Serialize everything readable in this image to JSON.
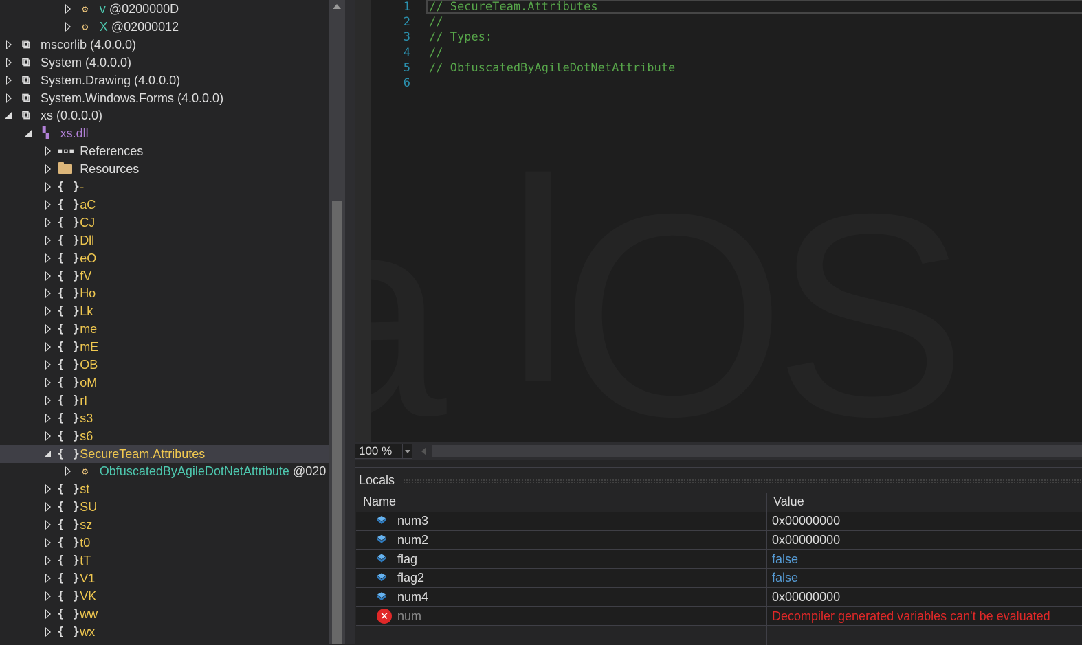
{
  "tree": [
    {
      "label": "v",
      "suffix": " @0200000D",
      "color": "teal",
      "icon": "type-attribute-icon",
      "expander": "collapsed"
    },
    {
      "label": "X",
      "suffix": " @02000012",
      "color": "teal",
      "icon": "type-attribute-icon",
      "expander": "collapsed"
    },
    {
      "label": "mscorlib",
      "suffix": " (4.0.0.0)",
      "color": "white",
      "icon": "assembly-icon",
      "expander": "collapsed"
    },
    {
      "label": "System",
      "suffix": " (4.0.0.0)",
      "color": "white",
      "icon": "assembly-icon",
      "expander": "collapsed"
    },
    {
      "label": "System.Drawing",
      "suffix": " (4.0.0.0)",
      "color": "white",
      "icon": "assembly-icon",
      "expander": "collapsed"
    },
    {
      "label": "System.Windows.Forms",
      "suffix": " (4.0.0.0)",
      "color": "white",
      "icon": "assembly-icon",
      "expander": "collapsed"
    },
    {
      "label": "xs",
      "suffix": " (0.0.0.0)",
      "color": "white",
      "icon": "assembly-icon",
      "expander": "expanded"
    },
    {
      "label": "xs.dll",
      "suffix": "",
      "color": "purple",
      "icon": "module-icon",
      "expander": "expanded"
    },
    {
      "label": "References",
      "suffix": "",
      "color": "white",
      "icon": "references-icon",
      "expander": "collapsed"
    },
    {
      "label": "Resources",
      "suffix": "",
      "color": "white",
      "icon": "folder-icon",
      "expander": "collapsed"
    },
    {
      "label": "-",
      "suffix": "",
      "color": "yellow",
      "icon": "namespace-icon",
      "expander": "collapsed"
    },
    {
      "label": "aC",
      "suffix": "",
      "color": "yellow",
      "icon": "namespace-icon",
      "expander": "collapsed"
    },
    {
      "label": "CJ",
      "suffix": "",
      "color": "yellow",
      "icon": "namespace-icon",
      "expander": "collapsed"
    },
    {
      "label": "Dll",
      "suffix": "",
      "color": "yellow",
      "icon": "namespace-icon",
      "expander": "collapsed"
    },
    {
      "label": "eO",
      "suffix": "",
      "color": "yellow",
      "icon": "namespace-icon",
      "expander": "collapsed"
    },
    {
      "label": "fV",
      "suffix": "",
      "color": "yellow",
      "icon": "namespace-icon",
      "expander": "collapsed"
    },
    {
      "label": "Ho",
      "suffix": "",
      "color": "yellow",
      "icon": "namespace-icon",
      "expander": "collapsed"
    },
    {
      "label": "Lk",
      "suffix": "",
      "color": "yellow",
      "icon": "namespace-icon",
      "expander": "collapsed"
    },
    {
      "label": "me",
      "suffix": "",
      "color": "yellow",
      "icon": "namespace-icon",
      "expander": "collapsed"
    },
    {
      "label": "mE",
      "suffix": "",
      "color": "yellow",
      "icon": "namespace-icon",
      "expander": "collapsed"
    },
    {
      "label": "OB",
      "suffix": "",
      "color": "yellow",
      "icon": "namespace-icon",
      "expander": "collapsed"
    },
    {
      "label": "oM",
      "suffix": "",
      "color": "yellow",
      "icon": "namespace-icon",
      "expander": "collapsed"
    },
    {
      "label": "rI",
      "suffix": "",
      "color": "yellow",
      "icon": "namespace-icon",
      "expander": "collapsed"
    },
    {
      "label": "s3",
      "suffix": "",
      "color": "yellow",
      "icon": "namespace-icon",
      "expander": "collapsed"
    },
    {
      "label": "s6",
      "suffix": "",
      "color": "yellow",
      "icon": "namespace-icon",
      "expander": "collapsed"
    },
    {
      "label": "SecureTeam.Attributes",
      "suffix": "",
      "color": "yellow",
      "icon": "namespace-icon",
      "expander": "expanded",
      "selected": true
    },
    {
      "label": "ObfuscatedByAgileDotNetAttribute",
      "suffix": " @020",
      "color": "teal",
      "icon": "type-attribute-icon",
      "expander": "collapsed"
    },
    {
      "label": "st",
      "suffix": "",
      "color": "yellow",
      "icon": "namespace-icon",
      "expander": "collapsed"
    },
    {
      "label": "SU",
      "suffix": "",
      "color": "yellow",
      "icon": "namespace-icon",
      "expander": "collapsed"
    },
    {
      "label": "sz",
      "suffix": "",
      "color": "yellow",
      "icon": "namespace-icon",
      "expander": "collapsed"
    },
    {
      "label": "t0",
      "suffix": "",
      "color": "yellow",
      "icon": "namespace-icon",
      "expander": "collapsed"
    },
    {
      "label": "tT",
      "suffix": "",
      "color": "yellow",
      "icon": "namespace-icon",
      "expander": "collapsed"
    },
    {
      "label": "V1",
      "suffix": "",
      "color": "yellow",
      "icon": "namespace-icon",
      "expander": "collapsed"
    },
    {
      "label": "VK",
      "suffix": "",
      "color": "yellow",
      "icon": "namespace-icon",
      "expander": "collapsed"
    },
    {
      "label": "ww",
      "suffix": "",
      "color": "yellow",
      "icon": "namespace-icon",
      "expander": "collapsed"
    },
    {
      "label": "wx",
      "suffix": "",
      "color": "yellow",
      "icon": "namespace-icon",
      "expander": "collapsed"
    }
  ],
  "editor": {
    "lines": [
      {
        "no": "1",
        "text": "// SecureTeam.Attributes"
      },
      {
        "no": "2",
        "text": "//"
      },
      {
        "no": "3",
        "text": "// Types:"
      },
      {
        "no": "4",
        "text": "//"
      },
      {
        "no": "5",
        "text": "// ObfuscatedByAgileDotNetAttribute"
      },
      {
        "no": "6",
        "text": ""
      }
    ],
    "zoom": "100 %"
  },
  "locals": {
    "title": "Locals",
    "columns": {
      "name": "Name",
      "value": "Value"
    },
    "rows": [
      {
        "name": "num3",
        "value": "0x00000000",
        "kind": "num",
        "icon": "local-variable-icon"
      },
      {
        "name": "num2",
        "value": "0x00000000",
        "kind": "num",
        "icon": "local-variable-icon"
      },
      {
        "name": "flag",
        "value": "false",
        "kind": "bool",
        "icon": "local-variable-icon"
      },
      {
        "name": "flag2",
        "value": "false",
        "kind": "bool",
        "icon": "local-variable-icon"
      },
      {
        "name": "num4",
        "value": "0x00000000",
        "kind": "num",
        "icon": "local-variable-icon"
      },
      {
        "name": "num",
        "value": "Decompiler generated variables can't be evaluated",
        "kind": "err",
        "icon": "error-icon"
      }
    ]
  },
  "colors": {
    "background": "#252526",
    "editor_background": "#1e1e1e",
    "comment": "#57a64a",
    "line_number": "#2b91af",
    "namespace": "#f0c850",
    "type": "#4ec9b0",
    "module": "#b180d7",
    "bool_value": "#569cd6",
    "error": "#e02828"
  }
}
